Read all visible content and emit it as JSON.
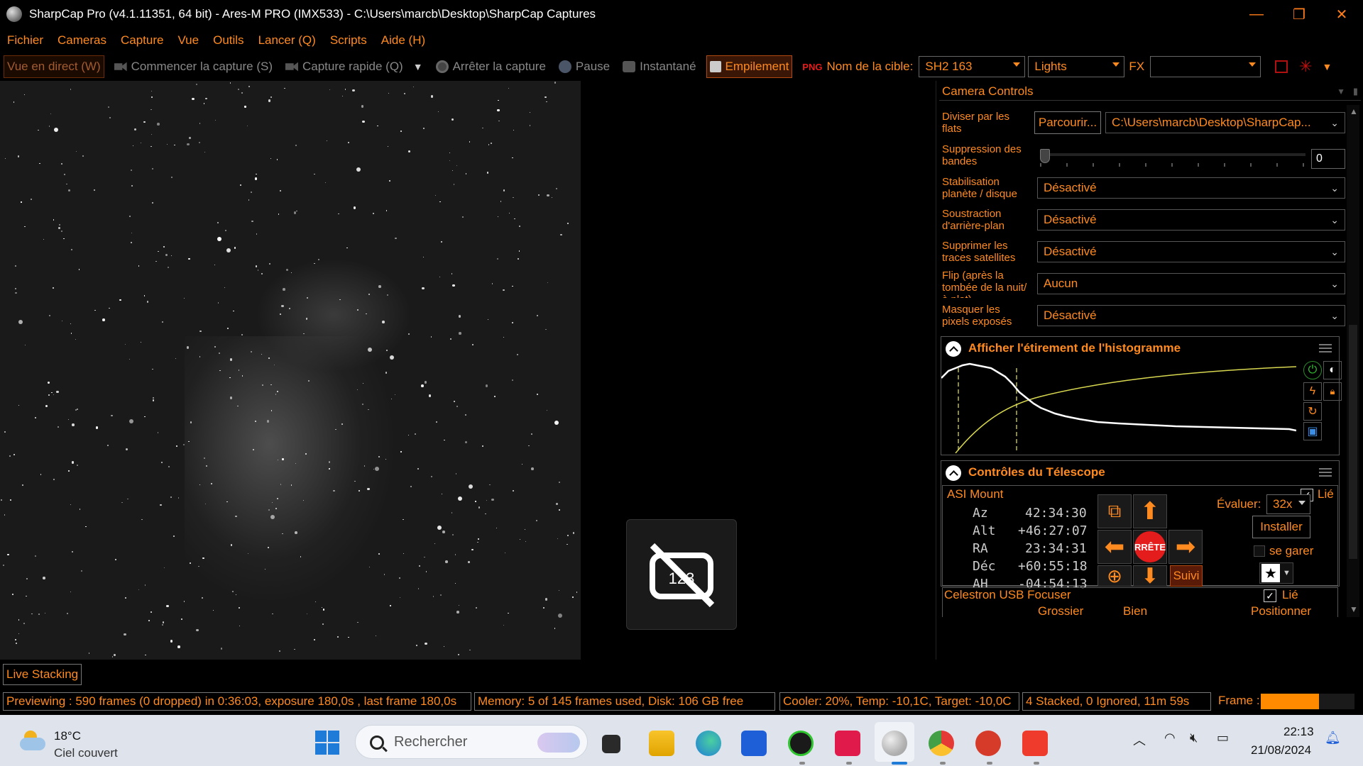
{
  "window": {
    "title": "SharpCap Pro (v4.1.11351, 64 bit) - Ares-M PRO (IMX533) - C:\\Users\\marcb\\Desktop\\SharpCap Captures",
    "min": "—",
    "max": "❐",
    "close": "✕"
  },
  "menu": [
    "Fichier",
    "Cameras",
    "Capture",
    "Vue",
    "Outils",
    "Lancer (Q)",
    "Scripts",
    "Aide (H)"
  ],
  "toolbar": {
    "live_view": "Vue en direct (W)",
    "start_capture": "Commencer la capture (S)",
    "quick_capture": "Capture rapide (Q)",
    "stop_capture": "Arrêter la capture",
    "pause": "Pause",
    "snapshot": "Instantané",
    "stacking": "Empilement",
    "target_label": "Nom de la cible:",
    "target_value": "SH2 163",
    "frame_type": "Lights",
    "fx_label": "FX",
    "fx_value": ""
  },
  "camera_controls": {
    "title": "Camera Controls",
    "flats_label": "Diviser par les flats",
    "browse_button": "Parcourir...",
    "flats_path": "C:\\Users\\marcb\\Desktop\\SharpCap...",
    "banding_label": "Suppression des bandes",
    "banding_value": "0",
    "stabilisation_label": "Stabilisation planète / disque",
    "stabilisation_value": "Désactivé",
    "background_label": "Soustraction d'arrière-plan",
    "background_value": "Désactivé",
    "satellite_label": "Supprimer les traces satellites",
    "satellite_value": "Désactivé",
    "flip_label": "Flip (après la tombée de la nuit/à plat)",
    "flip_value": "Aucun",
    "mask_label": "Masquer les pixels exposés",
    "mask_value": "Désactivé"
  },
  "histogram": {
    "title": "Afficher l'étirement de l'histogramme"
  },
  "telescope": {
    "title": "Contrôles du Télescope",
    "mount_name": "ASI Mount",
    "linked_label": "Lié",
    "az_label": "Az",
    "az_value": "42:34:30",
    "alt_label": "Alt",
    "alt_value": "+46:27:07",
    "ra_label": "RA",
    "ra_value": "23:34:31",
    "dec_label": "Déc",
    "dec_value": "+60:55:18",
    "ha_label": "AH",
    "ha_value": "-04:54:13",
    "stop_label": "RRÊTE",
    "rate_label": "Évaluer:",
    "rate_value": "32x",
    "install_button": "Installer",
    "park_label": "se garer",
    "track_button": "Suivi",
    "focuser_name": "Celestron USB Focuser",
    "focuser_linked": "Lié",
    "coarse_label": "Grossier",
    "fine_label": "Bien",
    "position_label": "Positionner"
  },
  "tabs": {
    "live_stacking": "Live Stacking"
  },
  "status": {
    "preview": "Previewing : 590 frames (0 dropped) in 0:36:03, exposure 180,0s , last frame 180,0s",
    "memory": "Memory: 5 of 145 frames used, Disk: 106 GB free",
    "cooler": "Cooler: 20%, Temp: -10,1C, Target: -10,0C",
    "stacked": "4 Stacked, 0 Ignored, 11m 59s",
    "frame_label": "Frame :",
    "frame_progress": 0.62
  },
  "taskbar": {
    "temperature": "18°C",
    "weather": "Ciel couvert",
    "search_placeholder": "Rechercher",
    "time": "22:13",
    "date": "21/08/2024"
  },
  "colors": {
    "accent": "#ff8a1f",
    "background": "#000000",
    "stop": "#e51c1c"
  }
}
